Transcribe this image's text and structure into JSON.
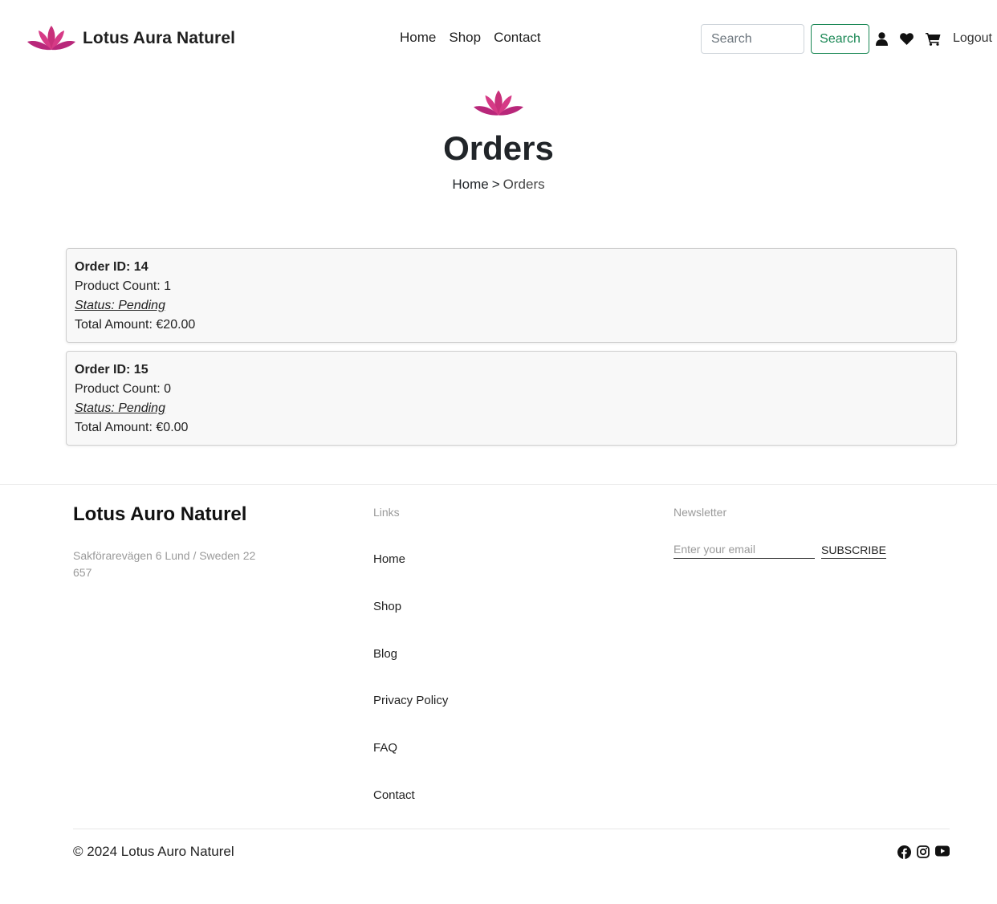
{
  "colors": {
    "accent_green": "#198754",
    "lotus_pink": "#d6337f",
    "text_dark": "#212529",
    "muted_gray": "#9a9a9a"
  },
  "header": {
    "brand_name": "Lotus Aura Naturel",
    "logo_icon": "lotus-icon",
    "nav": [
      {
        "label": "Home"
      },
      {
        "label": "Shop"
      },
      {
        "label": "Contact"
      }
    ],
    "search": {
      "placeholder": "Search",
      "value": "",
      "button_label": "Search"
    },
    "icons": [
      "user-icon",
      "heart-icon",
      "cart-icon"
    ],
    "logout_label": "Logout"
  },
  "hero": {
    "title": "Orders",
    "breadcrumb": {
      "home": "Home",
      "separator": ">",
      "current": "Orders"
    }
  },
  "orders": [
    {
      "id_text": "Order ID: 14",
      "product_count_text": "Product Count: 1",
      "status_text": "Status: Pending",
      "total_text": "Total Amount: €20.00"
    },
    {
      "id_text": "Order ID: 15",
      "product_count_text": "Product Count: 0",
      "status_text": "Status: Pending",
      "total_text": "Total Amount: €0.00"
    }
  ],
  "footer": {
    "brand_name": "Lotus Auro Naturel",
    "address": "Sakförarevägen 6 Lund / Sweden 22 657",
    "links_title": "Links",
    "links": [
      {
        "label": "Home"
      },
      {
        "label": "Shop"
      },
      {
        "label": "Blog"
      },
      {
        "label": "Privacy Policy"
      },
      {
        "label": "FAQ"
      },
      {
        "label": "Contact"
      }
    ],
    "newsletter_title": "Newsletter",
    "email_placeholder": "Enter your email",
    "subscribe_label": "SUBSCRIBE",
    "copyright": "© 2024 Lotus Auro Naturel",
    "social_icons": [
      "facebook-icon",
      "instagram-icon",
      "youtube-icon"
    ]
  }
}
